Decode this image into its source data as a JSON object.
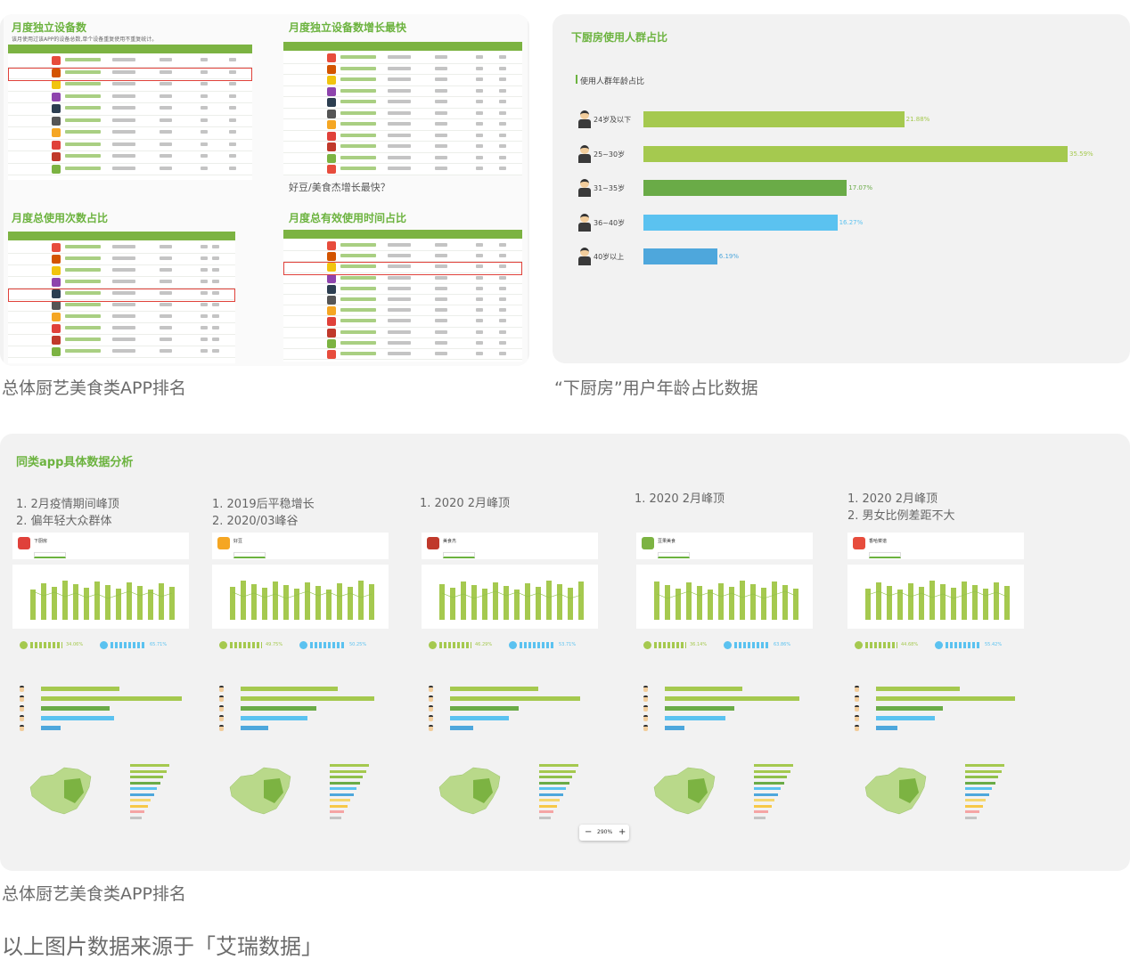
{
  "panel_ranking": {
    "t1": "月度独立设备数",
    "t1_note": "该月使用过该APP的设备总数,单个设备重复使用不重复统计。",
    "t2": "月度独立设备数增长最快",
    "t2_comment": "好豆/美食杰增长最快？",
    "t3": "月度总使用次数占比",
    "t4": "月度总有效使用时间占比",
    "caption": "总体厨艺美食类APP排名"
  },
  "panel_age": {
    "title": "下厨房使用人群占比",
    "subtitle": "使用人群年龄占比",
    "caption": "“下厨房”用户年龄占比数据"
  },
  "chart_data": {
    "type": "bar",
    "orientation": "horizontal",
    "title": "使用人群年龄占比",
    "categories": [
      "24岁及以下",
      "25~30岁",
      "31~35岁",
      "36~40岁",
      "40岁以上"
    ],
    "values": [
      21.88,
      35.59,
      17.07,
      16.27,
      6.19
    ],
    "value_labels": [
      "21.88%",
      "35.59%",
      "17.07%",
      "16.27%",
      "6.19%"
    ],
    "unit": "%",
    "xlim": [
      0,
      40
    ],
    "colors": [
      "#a5c94f",
      "#a5c94f",
      "#6aab47",
      "#5bc2f0",
      "#4ea7dc"
    ]
  },
  "panel_analysis": {
    "title": "同类app具体数据分析",
    "caption": "总体厨艺美食类APP排名",
    "cards": [
      {
        "note1": "1. 2月疫情期间峰顶",
        "note2": "2. 偏年轻大众群体",
        "app": "下厨房",
        "icon_color": "#e0413a",
        "pct1": "34.06%",
        "pct2": "65.71%"
      },
      {
        "note1": "1. 2019后平稳增长",
        "note2": "2. 2020/03峰谷",
        "app": "好豆",
        "icon_color": "#f5a623",
        "pct1": "49.75%",
        "pct2": "50.25%"
      },
      {
        "note1": "1. 2020 2月峰顶",
        "note2": "",
        "app": "美食杰",
        "icon_color": "#c0392b",
        "pct1": "46.29%",
        "pct2": "53.71%"
      },
      {
        "note1": "1. 2020 2月峰顶",
        "note2": "",
        "app": "豆果美食",
        "icon_color": "#7cb342",
        "pct1": "36.14%",
        "pct2": "63.86%"
      },
      {
        "note1": "1. 2020 2月峰顶",
        "note2": "2. 男女比例差距不大",
        "app": "香哈菜谱",
        "icon_color": "#e74c3c",
        "pct1": "44.68%",
        "pct2": "55.42%"
      }
    ],
    "zoom_level": "290%"
  },
  "footer_note": "以上图片数据来源于「艾瑞数据」",
  "colors": {
    "accent_green": "#6cb33f",
    "highlight_red": "#e0413a",
    "panel_bg": "#f2f2f2"
  }
}
